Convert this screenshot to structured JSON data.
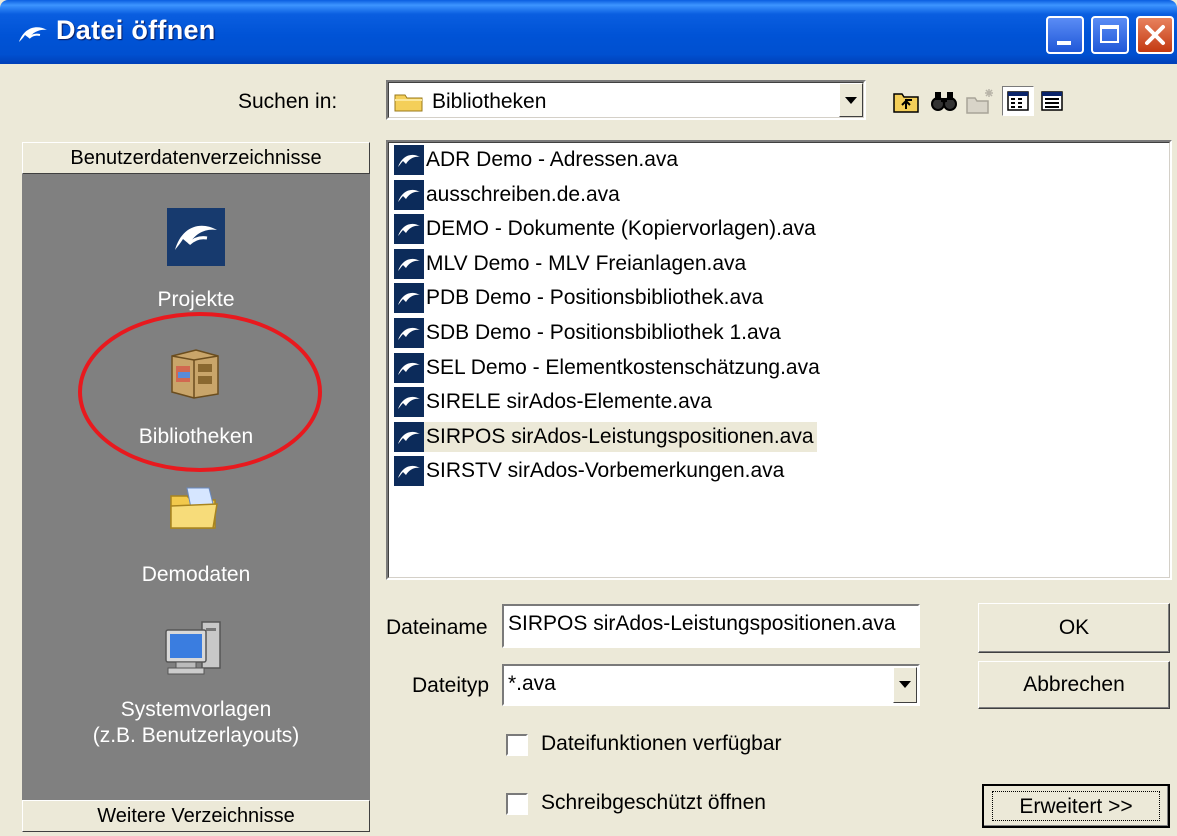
{
  "window": {
    "title": "Datei öffnen"
  },
  "lookin": {
    "label": "Suchen in:",
    "value": "Bibliotheken"
  },
  "toolbar": [
    "up-folder-icon",
    "find-icon",
    "new-folder-icon",
    "list-view-icon",
    "details-view-icon"
  ],
  "sidebar": {
    "header": "Benutzerdatenverzeichnisse",
    "items": [
      {
        "label": "Projekte",
        "icon": "dolphin-icon"
      },
      {
        "label": "Bibliotheken",
        "icon": "library-cabinet-icon"
      },
      {
        "label": "Demodaten",
        "icon": "folder-icon"
      },
      {
        "label_line1": "Systemvorlagen",
        "label_line2": "(z.B. Benutzerlayouts)",
        "icon": "computer-icon"
      }
    ],
    "footer": "Weitere Verzeichnisse"
  },
  "files": [
    {
      "name": "ADR Demo - Adressen.ava"
    },
    {
      "name": "ausschreiben.de.ava"
    },
    {
      "name": "DEMO - Dokumente (Kopiervorlagen).ava"
    },
    {
      "name": "MLV Demo - MLV Freianlagen.ava"
    },
    {
      "name": "PDB Demo - Positionsbibliothek.ava"
    },
    {
      "name": "SDB Demo - Positionsbibliothek 1.ava"
    },
    {
      "name": "SEL Demo - Elementkostenschätzung.ava"
    },
    {
      "name": "SIRELE sirAdos-Elemente.ava"
    },
    {
      "name": "SIRPOS sirAdos-Leistungspositionen.ava"
    },
    {
      "name": "SIRSTV sirAdos-Vorbemerkungen.ava"
    }
  ],
  "selected_file": "SIRPOS sirAdos-Leistungspositionen.ava",
  "form": {
    "filename_label": "Dateiname",
    "filename_value": "SIRPOS sirAdos-Leistungspositionen.ava",
    "filetype_label": "Dateityp",
    "filetype_value": "*.ava",
    "ok_label": "OK",
    "cancel_label": "Abbrechen",
    "file_functions_label": "Dateifunktionen verfügbar",
    "file_functions_checked": false,
    "readonly_label": "Schreibgeschützt öffnen",
    "readonly_checked": false,
    "advanced_label": "Erweitert >>"
  },
  "colors": {
    "titlebar": "#0053d6",
    "sidebar": "#808080",
    "highlight": "#e8191e",
    "file_icon_bg": "#0c2b5a"
  }
}
